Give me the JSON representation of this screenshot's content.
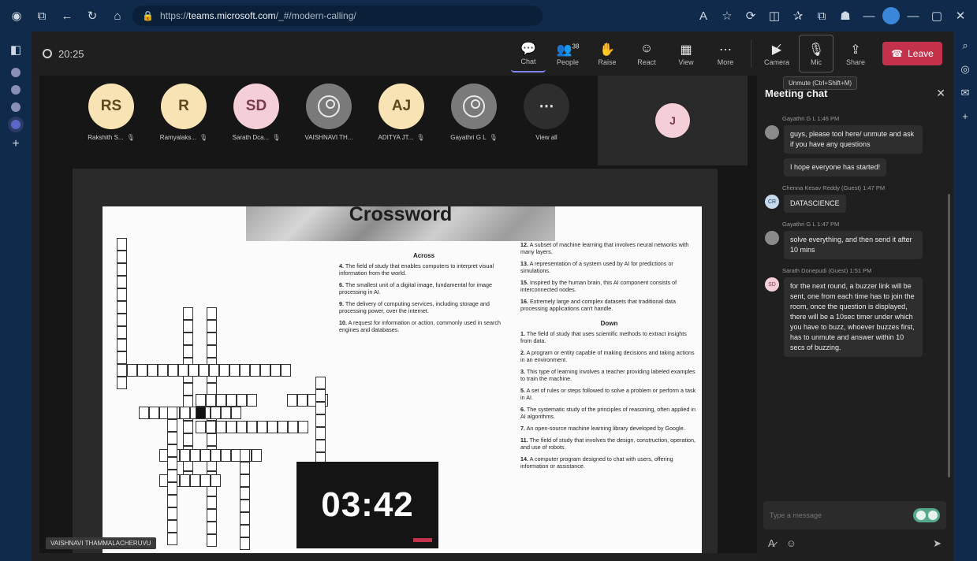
{
  "browser": {
    "url_prefix": "https://",
    "url_host": "teams.microsoft.com",
    "url_rest": "/_#/modern-calling/"
  },
  "meeting": {
    "elapsed": "20:25",
    "toolbar": [
      {
        "label": "Chat",
        "icon": "chat-icon",
        "glyph": "💬"
      },
      {
        "label": "People",
        "icon": "people-icon",
        "glyph": "👥",
        "count": "38"
      },
      {
        "label": "Raise",
        "icon": "hand-icon",
        "glyph": "✋"
      },
      {
        "label": "React",
        "icon": "smile-icon",
        "glyph": "☺"
      },
      {
        "label": "View",
        "icon": "grid-icon",
        "glyph": "▦"
      },
      {
        "label": "More",
        "icon": "more-icon",
        "glyph": "⋯"
      }
    ],
    "camera_label": "Camera",
    "mic_label": "Mic",
    "share_label": "Share",
    "leave_label": "Leave",
    "mic_tooltip": "Unmute (Ctrl+Shift+M)"
  },
  "participants": [
    {
      "initials": "RS",
      "name": "Rakshith S...",
      "style": "cream"
    },
    {
      "initials": "R",
      "name": "Ramyalaks...",
      "style": "cream"
    },
    {
      "initials": "SD",
      "name": "Sarath Dca...",
      "style": "pink"
    },
    {
      "initials": "",
      "name": "VAISHNAVI TH...",
      "style": "gray"
    },
    {
      "initials": "AJ",
      "name": "ADITYA JT...",
      "style": "cream"
    },
    {
      "initials": "",
      "name": "Gayathri G L",
      "style": "gray"
    },
    {
      "initials": "⋯",
      "name": "View all",
      "style": "dark"
    }
  ],
  "side_tile_initial": "J",
  "presenter_name": "VAISHNAVI THAMMALACHERUVU",
  "crossword": {
    "title": "Crossword",
    "across_head": "Across",
    "down_head": "Down",
    "across_a": [
      {
        "n": "4.",
        "t": "The field of study that enables computers to interpret visual information from the world."
      },
      {
        "n": "6.",
        "t": "The smallest unit of a digital image, fundamental for image processing in AI."
      },
      {
        "n": "9.",
        "t": "The delivery of computing services, including storage and processing power, over the internet."
      },
      {
        "n": "10.",
        "t": "A request for information or action, commonly used in search engines and databases."
      }
    ],
    "across_b": [
      {
        "n": "12.",
        "t": "A subset of machine learning that involves neural networks with many layers."
      },
      {
        "n": "13.",
        "t": "A representation of a system used by AI for predictions or simulations."
      },
      {
        "n": "15.",
        "t": "Inspired by the human brain, this AI component consists of interconnected nodes."
      },
      {
        "n": "16.",
        "t": "Extremely large and complex datasets that traditional data processing applications can't handle."
      }
    ],
    "down": [
      {
        "n": "1.",
        "t": "The field of study that uses scientific methods to extract insights from data."
      },
      {
        "n": "2.",
        "t": "A program or entity capable of making decisions and taking actions in an environment."
      },
      {
        "n": "3.",
        "t": "This type of learning involves a teacher providing labeled examples to train the machine."
      },
      {
        "n": "5.",
        "t": "A set of rules or steps followed to solve a problem or perform a task in AI."
      },
      {
        "n": "6.",
        "t": "The systematic study of the principles of reasoning, often applied in AI algorithms."
      },
      {
        "n": "7.",
        "t": "An open-source machine learning library developed by Google."
      },
      {
        "n": "11.",
        "t": "The field of study that involves the design, construction, operation, and use of robots."
      },
      {
        "n": "14.",
        "t": "A computer program designed to chat with users, offering information or assistance."
      }
    ]
  },
  "countdown": "03:42",
  "chat": {
    "title": "Meeting chat",
    "placeholder": "Type a message",
    "messages": [
      {
        "author": "Gayathri G L",
        "time": "1:46 PM",
        "avatar": "gray",
        "av_text": "",
        "text": "guys, please tool here/ unmute and ask if you have any questions",
        "extra": "I hope everyone has started!"
      },
      {
        "author": "Chenna Kesav Reddy (Guest)",
        "time": "1:47 PM",
        "avatar": "blue",
        "av_text": "CR",
        "text": "DATASCIENCE",
        "extra": ""
      },
      {
        "author": "Gayathri G L",
        "time": "1:47 PM",
        "avatar": "gray",
        "av_text": "",
        "text": "solve everything, and then send it after 10 mins",
        "extra": ""
      },
      {
        "author": "Sarath Donepudi (Guest)",
        "time": "1:51 PM",
        "avatar": "pink",
        "av_text": "SD",
        "text": "for the next round, a buzzer link will be sent, one from each time has to join the room, once the question is displayed, there will be a 10sec timer under which you have to buzz, whoever buzzes first, has to unmute and answer within 10 secs of buzzing.",
        "extra": ""
      }
    ]
  }
}
